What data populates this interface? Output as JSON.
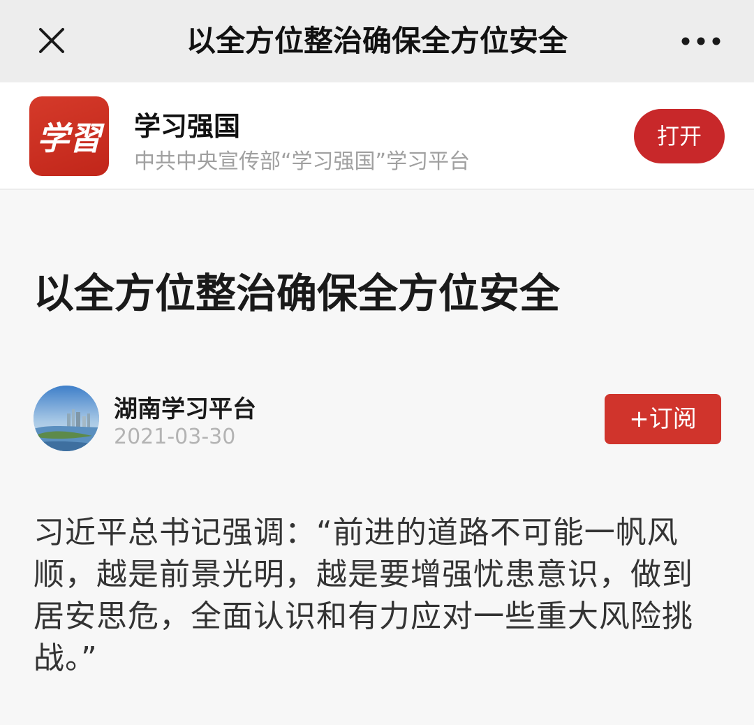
{
  "navbar": {
    "title": "以全方位整治确保全方位安全",
    "close_icon": "close-icon",
    "more_icon": "more-icon"
  },
  "app_banner": {
    "name": "学习强国",
    "description": "中共中央宣传部“学习强国”学习平台",
    "open_label": "打开",
    "logo_text": "学習"
  },
  "article": {
    "title": "以全方位整治确保全方位安全",
    "author": {
      "name": "湖南学习平台",
      "date": "2021-03-30"
    },
    "subscribe_label": "+订阅",
    "body_lines": [
      "习近平总书记强调：“前进的道路不可能一帆风",
      "顺，越是前景光明，越是要增强忧患意识，做到",
      "居安思危，全面认识和有力应对一些重大风险挑",
      "战。”"
    ]
  },
  "colors": {
    "brand_red": "#c8282a",
    "subscribe_red": "#d0342c",
    "navbar_bg": "#ededed",
    "page_bg": "#f7f7f7"
  }
}
